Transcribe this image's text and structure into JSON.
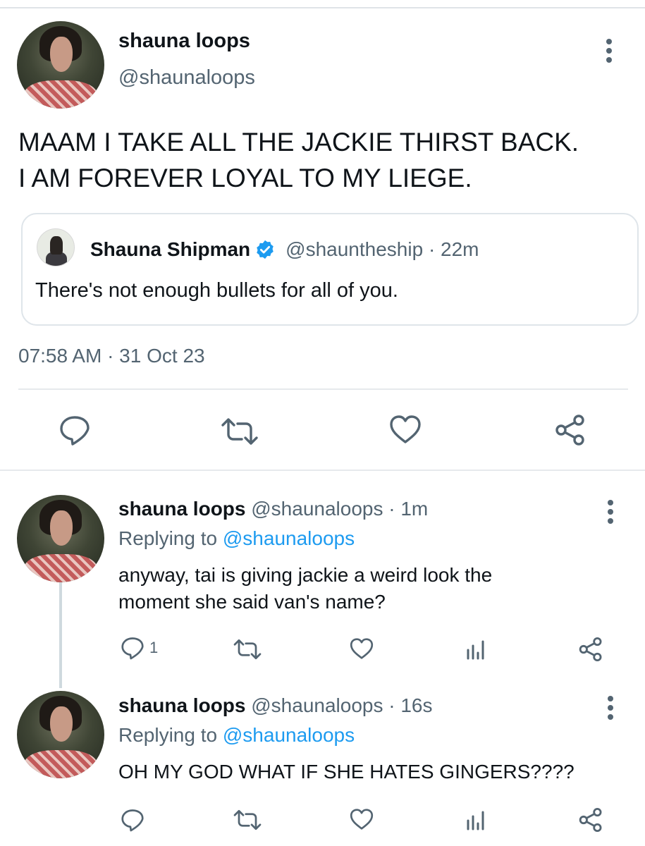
{
  "main_tweet": {
    "display_name": "shauna loops",
    "handle": "@shaunaloops",
    "text_line1": "MAAM I TAKE ALL THE JACKIE THIRST BACK.",
    "text_line2": "I AM FOREVER LOYAL TO MY LIEGE.",
    "timestamp": "07:58 AM · 31 Oct 23",
    "actions": [
      "reply-icon",
      "retweet-icon",
      "like-icon",
      "share-icon"
    ]
  },
  "quoted_tweet": {
    "display_name": "Shauna Shipman",
    "verified": true,
    "handle_time": "@shauntheship · 22m",
    "text": "There's not enough bullets for all of you."
  },
  "replies": [
    {
      "display_name": "shauna loops",
      "handle_time": "@shaunaloops · 1m",
      "replying_prefix": "Replying to ",
      "replying_to": "@shaunaloops",
      "text_line1": "anyway, tai is giving jackie a weird look the",
      "text_line2": "moment she said van's name?",
      "reply_count": "1"
    },
    {
      "display_name": "shauna loops",
      "handle_time": "@shaunaloops · 16s",
      "replying_prefix": "Replying to ",
      "replying_to": "@shaunaloops",
      "text_line1": "OH MY GOD WHAT IF SHE HATES GINGERS????",
      "reply_count": ""
    }
  ],
  "colors": {
    "text": "#0f1419",
    "secondary": "#536471",
    "link": "#1d9bf0",
    "verified": "#1d9bf0",
    "divider": "#e6e9ec"
  }
}
